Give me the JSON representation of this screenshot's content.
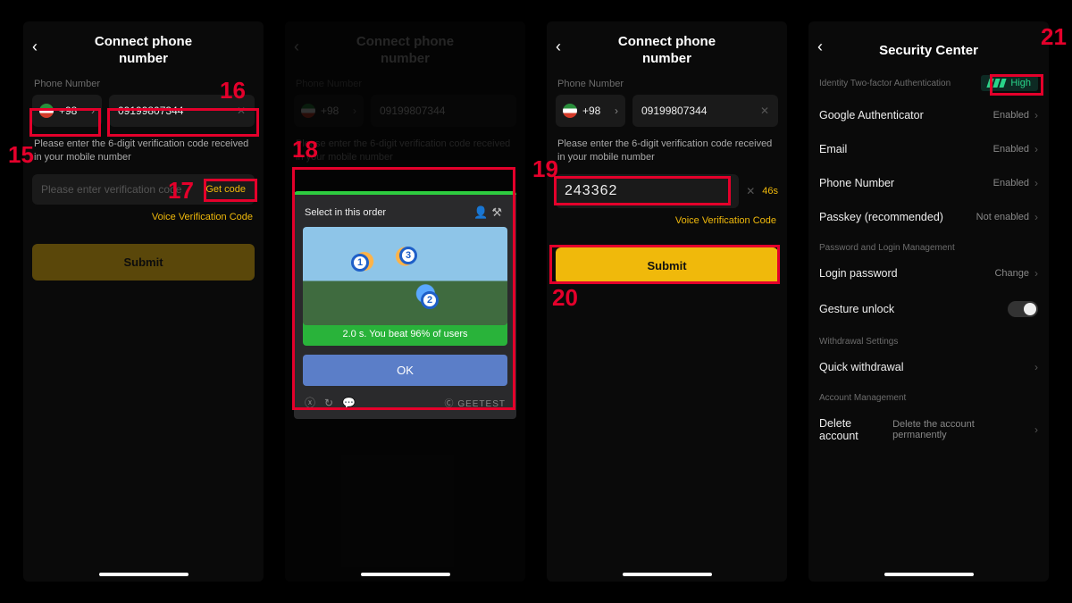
{
  "annotations": [
    "15",
    "16",
    "17",
    "18",
    "19",
    "20",
    "21"
  ],
  "screen1": {
    "title": "Connect phone\nnumber",
    "phone_label": "Phone Number",
    "country_code": "+98",
    "phone_value": "09199807344",
    "hint": "Please enter the 6-digit verification code received in your mobile number",
    "code_placeholder": "Please enter verification code",
    "get_code": "Get code",
    "voice_link": "Voice Verification Code",
    "submit": "Submit"
  },
  "screen2": {
    "title": "Connect phone\nnumber",
    "phone_label": "Phone Number",
    "country_code": "+98",
    "phone_value": "09199807344",
    "hint": "Please enter the 6-digit verification code received in your mobile number",
    "captcha_title": "Select in this order",
    "captcha_result": "2.0 s. You beat 96% of users",
    "captcha_ok": "OK",
    "captcha_brand": "GEETEST"
  },
  "screen3": {
    "title": "Connect phone\nnumber",
    "phone_label": "Phone Number",
    "country_code": "+98",
    "phone_value": "09199807344",
    "hint": "Please enter the 6-digit verification code received in your mobile number",
    "code_value": "243362",
    "countdown": "46s",
    "voice_link": "Voice Verification Code",
    "submit": "Submit"
  },
  "screen4": {
    "title": "Security Center",
    "sub": "Identity Two-factor Authentication",
    "high": "High",
    "rows_auth": [
      {
        "label": "Google Authenticator",
        "value": "Enabled"
      },
      {
        "label": "Email",
        "value": "Enabled"
      },
      {
        "label": "Phone Number",
        "value": "Enabled"
      },
      {
        "label": "Passkey (recommended)",
        "value": "Not enabled"
      }
    ],
    "section_pw": "Password and Login Management",
    "login_pw": {
      "label": "Login password",
      "value": "Change"
    },
    "gesture": "Gesture unlock",
    "section_wd": "Withdrawal Settings",
    "quick_wd": "Quick withdrawal",
    "section_acct": "Account Management",
    "delete": {
      "label": "Delete account",
      "value": "Delete the account permanently"
    }
  }
}
